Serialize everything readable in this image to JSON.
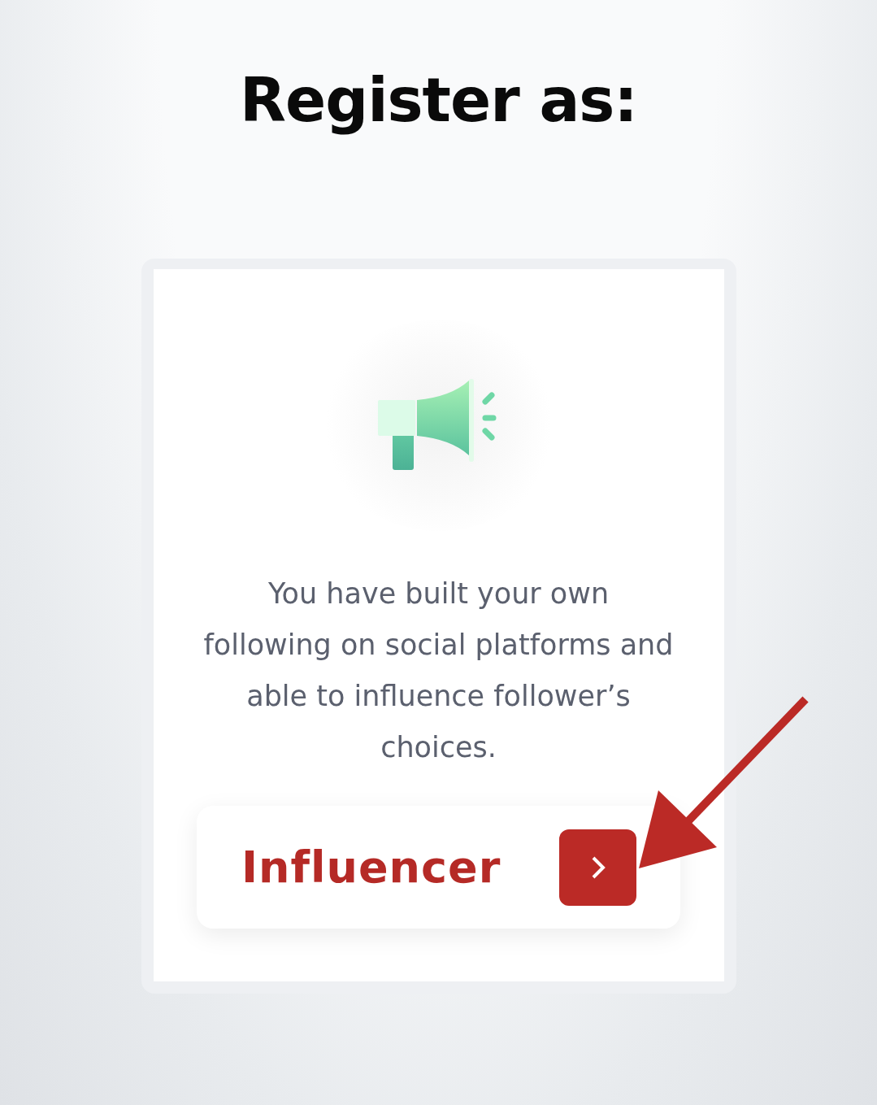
{
  "heading": "Register as:",
  "card": {
    "description": "You have built your own following on social platforms and able to influence follower’s choices.",
    "button": {
      "label": "Influencer"
    }
  },
  "annotation": {
    "kind": "arrow"
  }
}
